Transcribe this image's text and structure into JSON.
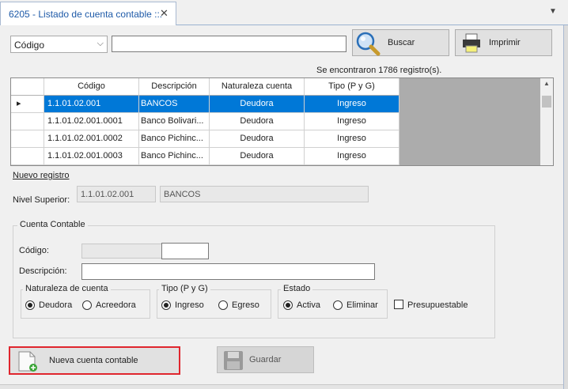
{
  "tab": {
    "title": "6205 - Listado de cuenta contable ::.",
    "close": "✕",
    "dropdown": "▼"
  },
  "search": {
    "field_selected": "Código",
    "query": "",
    "search_button": "Buscar",
    "print_button": "Imprimir"
  },
  "results_text": "Se encontraron 1786 registro(s).",
  "grid": {
    "columns": [
      "Código",
      "Descripción",
      "Naturaleza cuenta",
      "Tipo (P y G)"
    ],
    "rows": [
      {
        "codigo": "1.1.01.02.001",
        "descripcion": "BANCOS",
        "naturaleza": "Deudora",
        "tipo": "Ingreso",
        "selected": true
      },
      {
        "codigo": "1.1.01.02.001.0001",
        "descripcion": "Banco Bolivari...",
        "naturaleza": "Deudora",
        "tipo": "Ingreso",
        "selected": false
      },
      {
        "codigo": "1.1.01.02.001.0002",
        "descripcion": "Banco Pichinc...",
        "naturaleza": "Deudora",
        "tipo": "Ingreso",
        "selected": false
      },
      {
        "codigo": "1.1.01.02.001.0003",
        "descripcion": "Banco Pichinc...",
        "naturaleza": "Deudora",
        "tipo": "Ingreso",
        "selected": false
      }
    ]
  },
  "new_record_link": "Nuevo registro",
  "nivel_superior": {
    "label": "Nivel Superior:",
    "code": "1.1.01.02.001",
    "name": "BANCOS"
  },
  "cuenta_contable": {
    "title": "Cuenta Contable",
    "codigo_label": "Código:",
    "codigo_prefix": "",
    "codigo_value": "",
    "descripcion_label": "Descripción:",
    "descripcion_value": "",
    "naturaleza": {
      "title": "Naturaleza de cuenta",
      "options": [
        "Deudora",
        "Acreedora"
      ],
      "selected": "Deudora"
    },
    "tipo": {
      "title": "Tipo (P y G)",
      "options": [
        "Ingreso",
        "Egreso"
      ],
      "selected": "Ingreso"
    },
    "estado": {
      "title": "Estado",
      "options": [
        "Activa",
        "Eliminar"
      ],
      "selected": "Activa"
    },
    "presupuestable_label": "Presupuestable",
    "presupuestable_checked": false
  },
  "actions": {
    "new_button": "Nueva cuenta contable",
    "save_button": "Guardar"
  },
  "colors": {
    "selection": "#0078d7",
    "highlight_border": "#e0262e",
    "link": "#1e5aa8"
  }
}
